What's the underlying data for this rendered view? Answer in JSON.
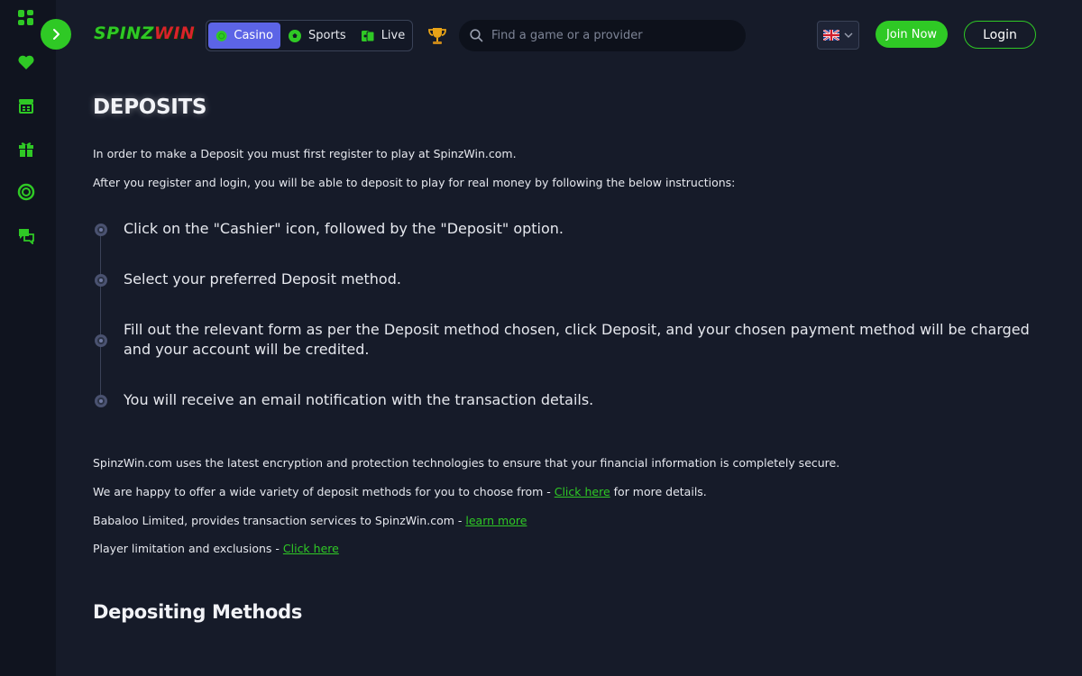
{
  "header": {
    "logo_part1": "SPINZ",
    "logo_part2": "WIN",
    "tabs": [
      {
        "label": "Casino",
        "active": true
      },
      {
        "label": "Sports",
        "active": false
      },
      {
        "label": "Live",
        "active": false
      }
    ],
    "search_placeholder": "Find a game or a provider",
    "join_label": "Join Now",
    "login_label": "Login"
  },
  "sidebar": {
    "icons": [
      "grid-icon",
      "heart-icon",
      "cashier-icon",
      "gift-icon",
      "ring-icon",
      "chat-icon"
    ]
  },
  "main": {
    "title": "DEPOSITS",
    "intro": [
      "In order to make a Deposit you must first register to play at SpinzWin.com.",
      "After you register and login, you will be able to deposit to play for real money by following the below instructions:"
    ],
    "steps": [
      "Click on the \"Cashier\" icon, followed by the \"Deposit\" option.",
      "Select your preferred Deposit method.",
      "Fill out the relevant form as per the Deposit method chosen, click Deposit, and your chosen payment method will be charged and your account will be credited.",
      "You will receive an email notification with the transaction details."
    ],
    "security_text": "SpinzWin.com uses the latest encryption and protection technologies to ensure that your financial information is completely secure.",
    "methods_text_before": "We are happy to offer a wide variety of deposit methods for you to choose from - ",
    "methods_link": "Click here",
    "methods_text_after": " for more details.",
    "babaloo_text": "Babaloo Limited, provides transaction services to SpinzWin.com - ",
    "babaloo_link": "learn more",
    "limits_text": "Player limitation and exclusions - ",
    "limits_link": "Click here",
    "section_title": "Depositing Methods"
  },
  "colors": {
    "accent": "#2fc925",
    "tab_active": "#5c64e6",
    "background": "#161b29",
    "sidebar": "#10141f"
  }
}
